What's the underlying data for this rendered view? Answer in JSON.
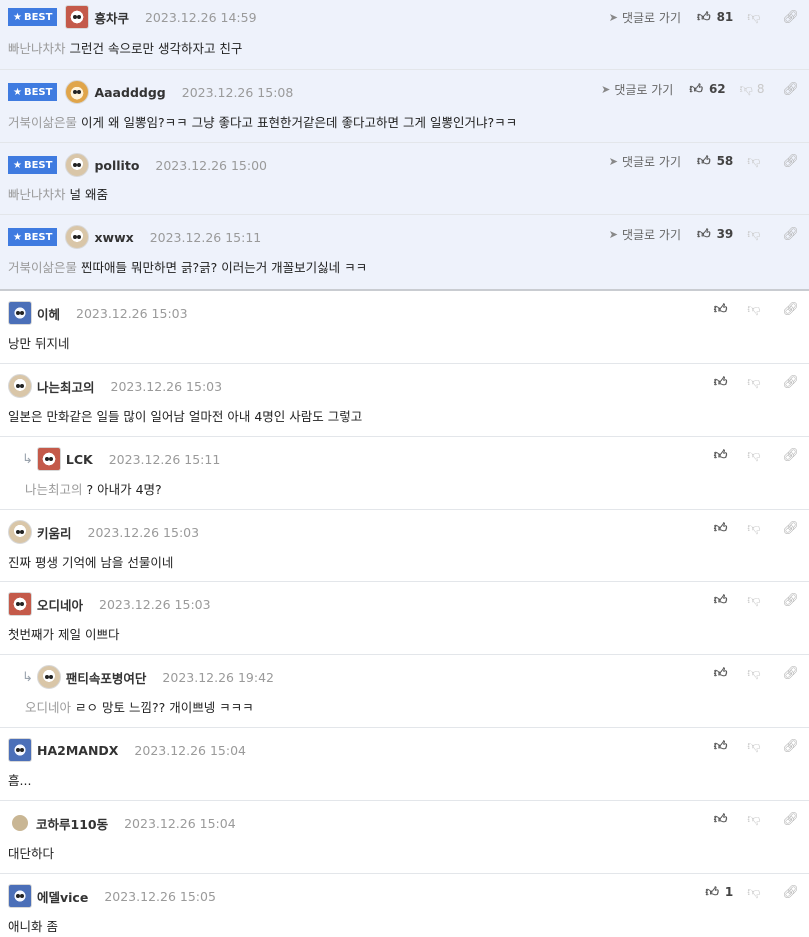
{
  "labels": {
    "best": "BEST",
    "goto": "댓글로 가기"
  },
  "best_comments": [
    {
      "nick": "흥차쿠",
      "time": "2023.12.26 14:59",
      "ref": "빠난나차차",
      "text": "그런건 속으로만 생각하자고 친구",
      "likes": "81",
      "dislikes": ""
    },
    {
      "nick": "Aaadddgg",
      "time": "2023.12.26 15:08",
      "ref": "거북이삶은물",
      "text": "이게 왜 일뽕임?ㅋㅋ 그냥 좋다고 표현한거같은데 좋다고하면 그게 일뽕인거냐?ㅋㅋ",
      "likes": "62",
      "dislikes": "8"
    },
    {
      "nick": "pollito",
      "time": "2023.12.26 15:00",
      "ref": "빠난나차차",
      "text": "널 왜줌",
      "likes": "58",
      "dislikes": ""
    },
    {
      "nick": "xwwx",
      "time": "2023.12.26 15:11",
      "ref": "거북이삶은물",
      "text": "찐따애들 뭐만하면 긁?긁? 이러는거 개꼴보기싫네 ㅋㅋ",
      "likes": "39",
      "dislikes": ""
    }
  ],
  "comments": [
    {
      "nick": "이헤",
      "time": "2023.12.26 15:03",
      "ref": "",
      "text": "낭만 뒤지네",
      "likes": ""
    },
    {
      "nick": "나는최고의",
      "time": "2023.12.26 15:03",
      "ref": "",
      "text": "일본은 만화같은 일들 많이 일어남 얼마전 아내 4명인 사람도 그렇고",
      "likes": ""
    },
    {
      "nick": "LCK",
      "time": "2023.12.26 15:11",
      "ref": "나는최고의",
      "text": "? 아내가 4명?",
      "likes": ""
    },
    {
      "nick": "키움리",
      "time": "2023.12.26 15:03",
      "ref": "",
      "text": "진짜 평생 기억에 남을 선물이네",
      "likes": ""
    },
    {
      "nick": "오디네아",
      "time": "2023.12.26 15:03",
      "ref": "",
      "text": "첫번째가 제일 이쁘다",
      "likes": ""
    },
    {
      "nick": "팬티속포병여단",
      "time": "2023.12.26 19:42",
      "ref": "오디네아",
      "text": "ㄹㅇ 망토 느낌?? 개이쁘넹 ㅋㅋㅋ",
      "likes": ""
    },
    {
      "nick": "HA2MANDX",
      "time": "2023.12.26 15:04",
      "ref": "",
      "text": "흠...",
      "likes": ""
    },
    {
      "nick": "코하루110동",
      "time": "2023.12.26 15:04",
      "ref": "",
      "text": "대단하다",
      "likes": ""
    },
    {
      "nick": "에델vice",
      "time": "2023.12.26 15:05",
      "ref": "",
      "text": "애니화 좀",
      "likes": "1"
    }
  ],
  "icons": {
    "best_star": "star-icon",
    "goto": "navigate-arrow-icon",
    "like": "thumb-up-icon",
    "dislike": "thumb-down-icon",
    "link": "link-icon",
    "reply": "reply-arrow-icon"
  },
  "colors": {
    "best_badge": "#3f7be0",
    "best_bg": "#eef2fb",
    "muted": "#9a9a9a"
  }
}
